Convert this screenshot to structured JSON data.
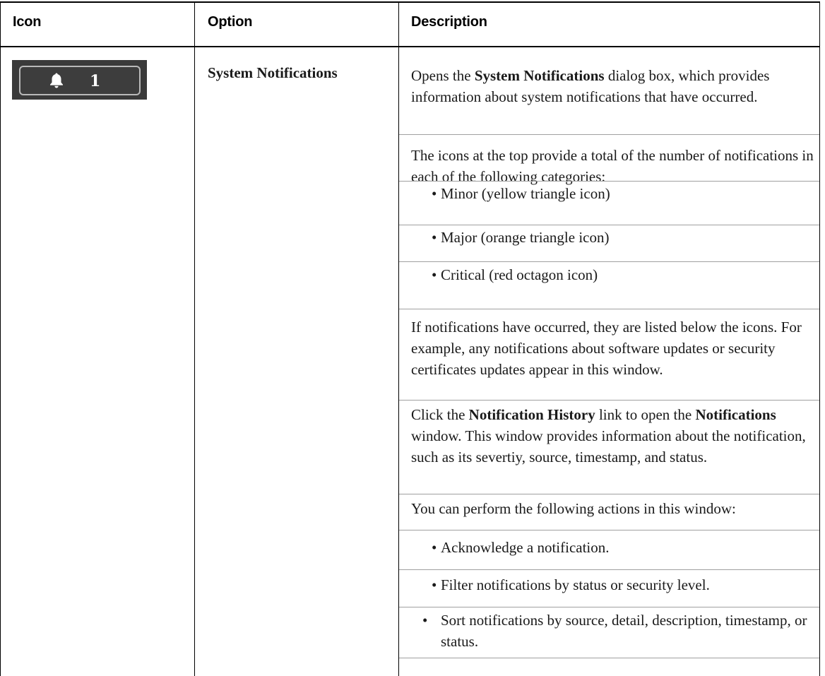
{
  "table": {
    "headers": {
      "icon": "Icon",
      "option": "Option",
      "description": "Description"
    },
    "row": {
      "icon_button": {
        "icon": "bell-icon",
        "count": "1"
      },
      "option": "System Notifications",
      "description": {
        "p1": {
          "pre": "Opens the ",
          "bold": "System Notifications",
          "post": " dialog box, which provides information about system notifications that have occurred."
        },
        "p2": "The icons at the top provide a total of the number of notifications in each of the following categories:",
        "categories": [
          "Minor (yellow triangle icon)",
          "Major (orange triangle icon)",
          "Critical (red octagon icon)"
        ],
        "p3": "If notifications have occurred, they are listed below the icons. For example, any notifications about software updates or security certificates updates appear in this window.",
        "p4": {
          "pre": "Click the ",
          "bold1": "Notification History",
          "mid": " link to open the ",
          "bold2": "Notifications",
          "post": " window. This window provides information about the notification, such as its severtiy, source, timestamp, and status."
        },
        "p5": "You can perform the following actions in this window:",
        "actions": [
          "Acknowledge a notification.",
          "Filter notifications by status or security level.",
          "Sort notifications by source, detail, description, timestamp, or status."
        ]
      }
    }
  }
}
